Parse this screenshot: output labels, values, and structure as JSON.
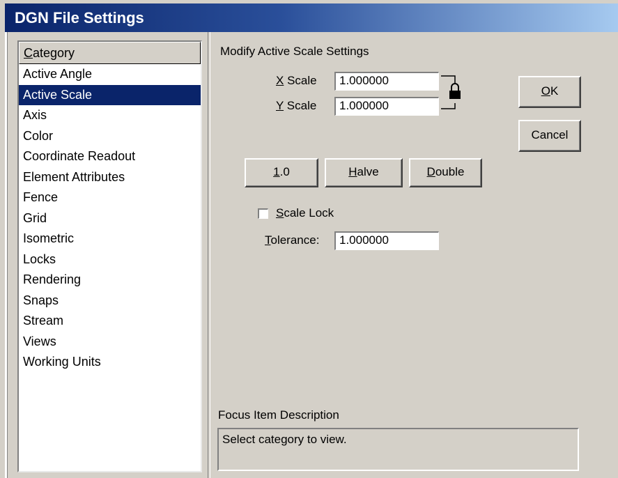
{
  "window": {
    "title": "DGN File Settings"
  },
  "category_list": {
    "header_prefix": "C",
    "header_rest": "ategory",
    "items": [
      "Active Angle",
      "Active Scale",
      "Axis",
      "Color",
      "Coordinate Readout",
      "Element Attributes",
      "Fence",
      "Grid",
      "Isometric",
      "Locks",
      "Rendering",
      "Snaps",
      "Stream",
      "Views",
      "Working Units"
    ],
    "selected": "Active Scale"
  },
  "panel": {
    "heading": "Modify Active Scale Settings",
    "x_scale": {
      "accel": "X",
      "label_rest": " Scale",
      "value": "1.000000"
    },
    "y_scale": {
      "accel": "Y",
      "label_rest": " Scale",
      "value": "1.000000"
    },
    "lock_icon": "padlock-icon",
    "buttons": {
      "one": {
        "accel": "1",
        "rest": ".0"
      },
      "halve": {
        "accel": "H",
        "rest": "alve"
      },
      "double": {
        "accel": "D",
        "rest": "ouble"
      }
    },
    "scale_lock": {
      "accel": "S",
      "label_rest": "cale Lock",
      "checked": false
    },
    "tolerance": {
      "accel": "T",
      "label_rest": "olerance:",
      "value": "1.000000"
    }
  },
  "dialog_buttons": {
    "ok": {
      "accel": "O",
      "rest": "K"
    },
    "cancel": {
      "label": "Cancel"
    }
  },
  "focus_description": {
    "label": "Focus Item Description",
    "text": "Select category to view."
  }
}
